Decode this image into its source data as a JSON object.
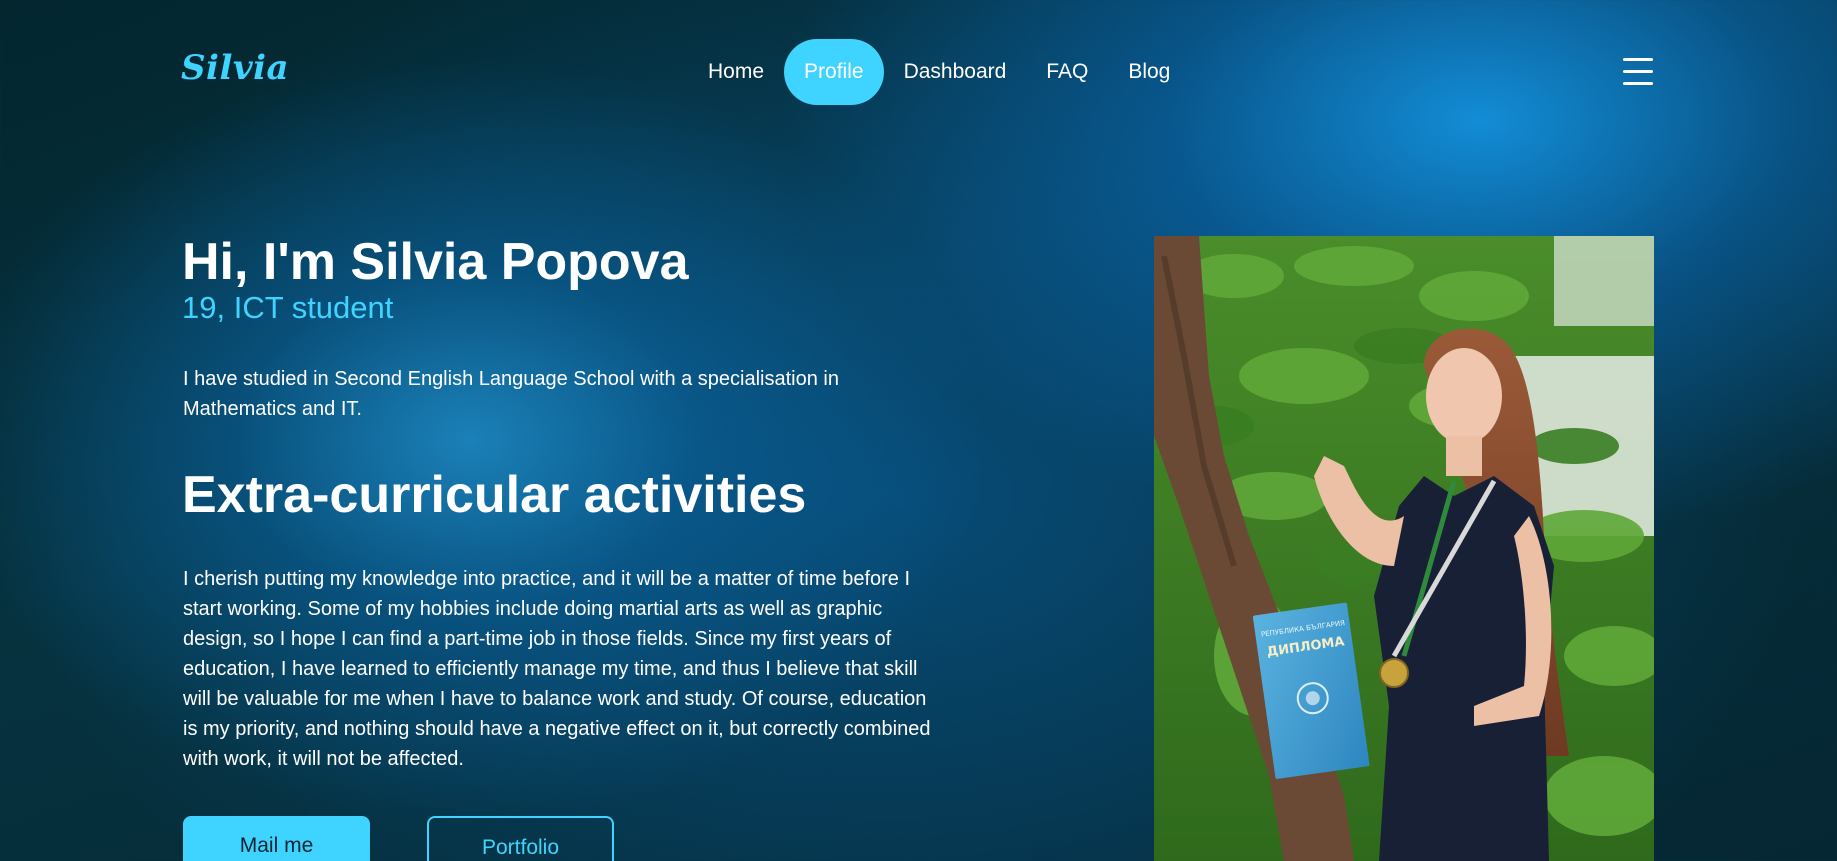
{
  "header": {
    "logo": "Silvia",
    "nav": [
      {
        "label": "Home",
        "active": false
      },
      {
        "label": "Profile",
        "active": true
      },
      {
        "label": "Dashboard",
        "active": false
      },
      {
        "label": "FAQ",
        "active": false
      },
      {
        "label": "Blog",
        "active": false
      }
    ],
    "menu_icon": "hamburger-menu-icon"
  },
  "hero": {
    "greeting": "Hi, I'm Silvia Popova",
    "subtitle": "19, ICT student",
    "intro": "I have studied in Second English Language School with a specialisation in Mathematics and IT.",
    "section_title": "Extra-curricular activities",
    "body": "I cherish putting my knowledge into practice, and it will be a matter of time before I start working. Some of my hobbies include doing martial arts as well as graphic design, so I hope I can find a part-time job in those fields. Since my first years of education, I have learned to efficiently manage my time, and thus I believe that skill will be valuable for me when I have to balance work and study. Of course, education is my priority, and nothing should have a negative effect on it, but correctly combined with work, it will not be affected.",
    "buttons": {
      "mail": "Mail me",
      "portfolio": "Portfolio"
    }
  },
  "photo": {
    "diploma_text": "ДИПЛОМА",
    "diploma_header": "РЕПУБЛИКА БЪЛГАРИЯ"
  },
  "colors": {
    "accent": "#3fd4ff",
    "background_dark": "#03262f",
    "background_glow": "#1496e6",
    "text": "#ffffff"
  }
}
